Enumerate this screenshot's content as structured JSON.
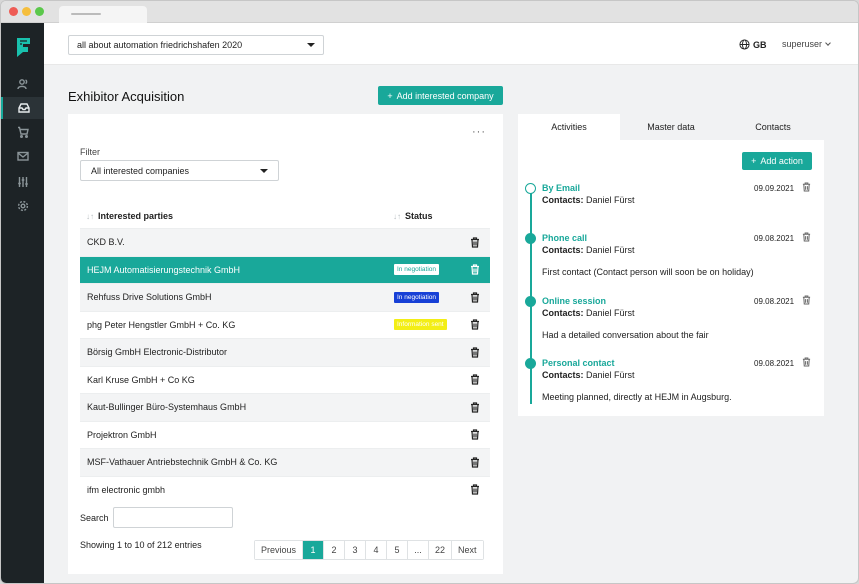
{
  "event": {
    "selected": "all about automation friedrichshafen 2020"
  },
  "header": {
    "language": "GB",
    "user": "superuser"
  },
  "page": {
    "title": "Exhibitor Acquisition",
    "add_company_label": "Add interested company"
  },
  "filter": {
    "label": "Filter",
    "selected": "All interested companies"
  },
  "table": {
    "columns": [
      "Interested parties",
      "Status"
    ],
    "rows": [
      {
        "name": "CKD B.V.",
        "status": ""
      },
      {
        "name": "HEJM Automatisierungstechnik GmbH",
        "status": "In negotiation"
      },
      {
        "name": "Rehfuss Drive Solutions GmbH",
        "status": "In negotiation"
      },
      {
        "name": "phg Peter Hengstler GmbH + Co. KG",
        "status": "Information sent"
      },
      {
        "name": "Börsig GmbH Electronic-Distributor",
        "status": ""
      },
      {
        "name": "Karl Kruse GmbH + Co KG",
        "status": ""
      },
      {
        "name": "Kaut-Bullinger Büro-Systemhaus GmbH",
        "status": ""
      },
      {
        "name": "Projektron GmbH",
        "status": ""
      },
      {
        "name": "MSF-Vathauer Antriebstechnik GmbH & Co. KG",
        "status": ""
      },
      {
        "name": "ifm electronic gmbh",
        "status": ""
      }
    ]
  },
  "search": {
    "label": "Search",
    "value": ""
  },
  "pagination": {
    "showing": "Showing 1 to 10 of 212 entries",
    "previous": "Previous",
    "pages": [
      "1",
      "2",
      "3",
      "4",
      "5",
      "...",
      "22"
    ],
    "next": "Next",
    "current": "1"
  },
  "right_panel": {
    "tabs": [
      "Activities",
      "Master data",
      "Contacts"
    ],
    "active_tab": "Activities",
    "add_action_label": "Add action",
    "contacts_label": "Contacts:",
    "activities": [
      {
        "type": "By Email",
        "contact": "Daniel Fürst",
        "date": "09.09.2021",
        "note": ""
      },
      {
        "type": "Phone call",
        "contact": "Daniel Fürst",
        "date": "09.08.2021",
        "note": "First contact (Contact person will soon be on holiday)"
      },
      {
        "type": "Online session",
        "contact": "Daniel Fürst",
        "date": "09.08.2021",
        "note": "Had a detailed conversation about the fair"
      },
      {
        "type": "Personal contact",
        "contact": "Daniel Fürst",
        "date": "09.08.2021",
        "note": "Meeting planned, directly at HEJM in Augsburg."
      }
    ]
  },
  "colors": {
    "accent": "#19a89a",
    "sidebar": "#1d2326",
    "badge_blue": "#1740d6",
    "badge_yellow": "#f3ee16"
  },
  "icons": [
    "users-icon",
    "inbox-icon",
    "cart-icon",
    "mail-icon",
    "sliders-icon",
    "settings-icon",
    "globe-icon",
    "trash-icon"
  ]
}
